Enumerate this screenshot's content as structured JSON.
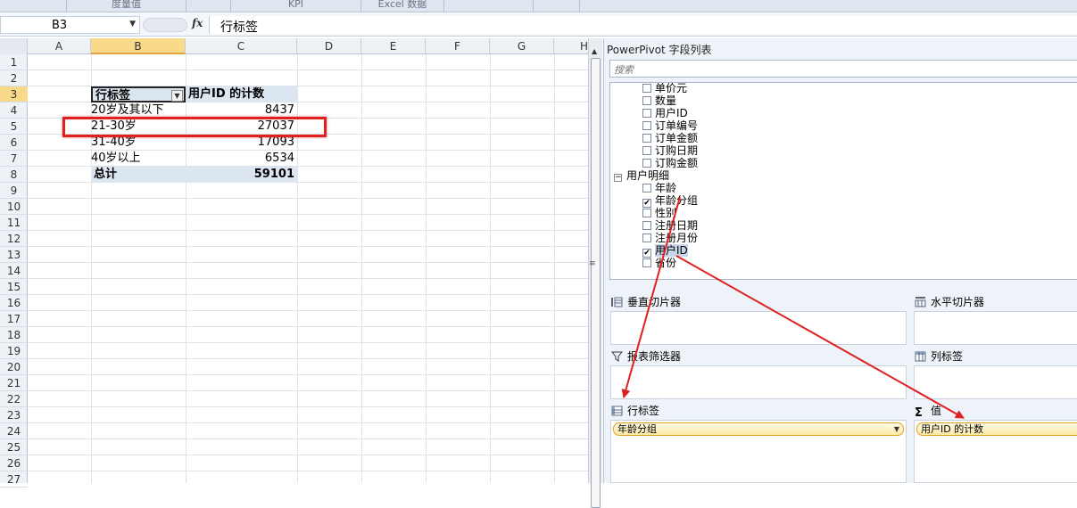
{
  "ribbon": {
    "segments": [
      "",
      "度量值",
      "",
      "KPI",
      "Excel 数据",
      "",
      ""
    ]
  },
  "formula_bar": {
    "cell_ref": "B3",
    "fx": "fx",
    "content": "行标签"
  },
  "columns": [
    "A",
    "B",
    "C",
    "D",
    "E",
    "F",
    "G",
    "H"
  ],
  "rows": [
    "1",
    "2",
    "3",
    "4",
    "5",
    "6",
    "7",
    "8",
    "9",
    "10",
    "11",
    "12",
    "13",
    "14",
    "15",
    "16",
    "17",
    "18",
    "19",
    "20",
    "21",
    "22",
    "23",
    "24",
    "25",
    "26",
    "27"
  ],
  "pivot": {
    "header_row": "行标签",
    "header_value": "用户ID 的计数",
    "rows": [
      {
        "label": "20岁及其以下",
        "value": "8437"
      },
      {
        "label": "21-30岁",
        "value": "27037"
      },
      {
        "label": "31-40岁",
        "value": "17093"
      },
      {
        "label": "40岁以上",
        "value": "6534"
      }
    ],
    "total_label": "总计",
    "total_value": "59101"
  },
  "pane": {
    "title": "PowerPivot 字段列表",
    "search_placeholder": "搜索",
    "order_fields": [
      {
        "label": "单价元",
        "checked": false
      },
      {
        "label": "数量",
        "checked": false
      },
      {
        "label": "用户ID",
        "checked": false
      },
      {
        "label": "订单编号",
        "checked": false
      },
      {
        "label": "订单金额",
        "checked": false
      },
      {
        "label": "订购日期",
        "checked": false
      },
      {
        "label": "订购金额",
        "checked": false
      }
    ],
    "table_name": "用户明细",
    "user_fields": [
      {
        "label": "年龄",
        "checked": false
      },
      {
        "label": "年龄分组",
        "checked": true
      },
      {
        "label": "性别",
        "checked": false
      },
      {
        "label": "注册日期",
        "checked": false
      },
      {
        "label": "注册月份",
        "checked": false
      },
      {
        "label": "用户ID",
        "checked": true
      },
      {
        "label": "省份",
        "checked": false
      }
    ],
    "zones": {
      "vertical_slicer": "垂直切片器",
      "horizontal_slicer": "水平切片器",
      "report_filter": "报表筛选器",
      "column_labels": "列标签",
      "row_labels": "行标签",
      "values": "值"
    },
    "row_label_field": "年龄分组",
    "value_field": "用户ID 的计数"
  },
  "colors": {
    "annotation_red": "#e02020",
    "pivot_header_bg": "#dce6f1",
    "selected_header": "#f9d98a"
  },
  "icons": [
    "dropdown-arrow-icon",
    "fx-icon",
    "filter-icon",
    "sigma-icon",
    "grid-icon",
    "checkbox-icon"
  ]
}
